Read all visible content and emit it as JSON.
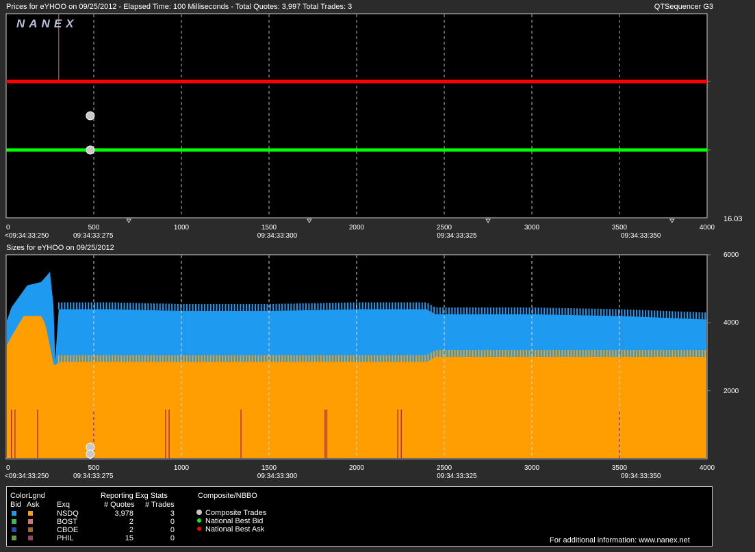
{
  "header": {
    "title": "Prices for  eYHOO  on  09/25/2012  -  Elapsed Time: 100 Milliseconds  -  Total Quotes: 3,997  Total Trades: 3",
    "app_name": "QTSequencer G3",
    "logo": "NANEX"
  },
  "sizes_header": {
    "title": "Sizes for  eYHOO  on  09/25/2012"
  },
  "chart_data": [
    {
      "type": "line",
      "title": "Prices for  eYHOO  on  09/25/2012",
      "x_ticks": [
        "0",
        "500",
        "1000",
        "1500",
        "2000",
        "2500",
        "3000",
        "3500",
        "4000"
      ],
      "x_range": [
        0,
        4000
      ],
      "time_labels": [
        "<09:34:33:250",
        "09:34:33:275",
        "09:34:33:300",
        "09:34:33:325",
        "09:34:33:350"
      ],
      "time_label_x": [
        0,
        500,
        1550,
        2575,
        3625
      ],
      "y_label": "16.03",
      "series": [
        {
          "name": "National Best Ask",
          "color": "#ff0000",
          "x": [
            0,
            4000
          ],
          "y": [
            1.0,
            1.0
          ]
        },
        {
          "name": "National Best Bid",
          "color": "#00ff00",
          "x": [
            0,
            4000
          ],
          "y": [
            0.0,
            0.0
          ]
        }
      ],
      "trades": [
        {
          "x": 480,
          "y": 0.5
        },
        {
          "x": 480,
          "y": 0.0
        }
      ],
      "grid": true
    },
    {
      "type": "area",
      "title": "Sizes for  eYHOO  on  09/25/2012",
      "x_ticks": [
        "0",
        "500",
        "1000",
        "1500",
        "2000",
        "2500",
        "3000",
        "3500",
        "4000"
      ],
      "x_range": [
        0,
        4000
      ],
      "time_labels": [
        "<09:34:33:250",
        "09:34:33:275",
        "09:34:33:300",
        "09:34:33:325",
        "09:34:33:350"
      ],
      "time_label_x": [
        0,
        500,
        1550,
        2575,
        3625
      ],
      "y_ticks": [
        "6000",
        "4000",
        "2000"
      ],
      "y_range": [
        0,
        6000
      ],
      "series": [
        {
          "name": "NSDQ Bid",
          "color": "#1e9bf0",
          "x": [
            0,
            30,
            120,
            200,
            250,
            270,
            280,
            300,
            600,
            1000,
            1500,
            2000,
            2400,
            2450,
            3000,
            3500,
            4000
          ],
          "y": [
            4000,
            4450,
            5100,
            5200,
            5500,
            4500,
            2900,
            4400,
            4400,
            4350,
            4350,
            4400,
            4400,
            4250,
            4250,
            4200,
            4100
          ]
        },
        {
          "name": "NSDQ Ask",
          "color": "#ff9e00",
          "x": [
            0,
            30,
            100,
            200,
            220,
            230,
            250,
            270,
            280,
            300,
            600,
            1000,
            1500,
            2000,
            2400,
            2450,
            3000,
            3500,
            4000
          ],
          "y": [
            3300,
            3600,
            4200,
            4200,
            4000,
            3800,
            3300,
            2800,
            2750,
            2850,
            2850,
            2850,
            2850,
            2850,
            2850,
            3000,
            3000,
            3000,
            3000
          ]
        }
      ],
      "spikes_x": [
        30,
        50,
        180,
        500,
        910,
        930,
        1340,
        1820,
        1830,
        2235,
        2255,
        3500,
        4000
      ],
      "trades": [
        {
          "x": 480,
          "y": 300
        },
        {
          "x": 480,
          "y": 100
        }
      ],
      "grid": true
    }
  ],
  "legend": {
    "headers": {
      "colorlgnd": "ColorLgnd",
      "bid": "Bid",
      "ask": "Ask",
      "exq": "Exq",
      "reporting": "Reporting Exg Stats",
      "quotes": "# Quotes",
      "trades": "# Trades",
      "composite": "Composite/NBBO"
    },
    "rows": [
      {
        "ex": "NSDQ",
        "quotes": "3,978",
        "trades": "3",
        "bid_color": "#1e9bf0",
        "ask_color": "#ff9e00"
      },
      {
        "ex": "BOST",
        "quotes": "2",
        "trades": "0",
        "bid_color": "#3cba54",
        "ask_color": "#d9736a"
      },
      {
        "ex": "CBOE",
        "quotes": "2",
        "trades": "0",
        "bid_color": "#1f4fa8",
        "ask_color": "#a06a20"
      },
      {
        "ex": "PHIL",
        "quotes": "15",
        "trades": "0",
        "bid_color": "#6a9a3a",
        "ask_color": "#a04060"
      }
    ],
    "composite": [
      {
        "label": "Composite Trades",
        "color": "#c8c8c8"
      },
      {
        "label": "National Best Bid",
        "color": "#00ff00"
      },
      {
        "label": "National Best Ask",
        "color": "#ff0000"
      }
    ],
    "footer": "For additional information: www.nanex.net"
  }
}
